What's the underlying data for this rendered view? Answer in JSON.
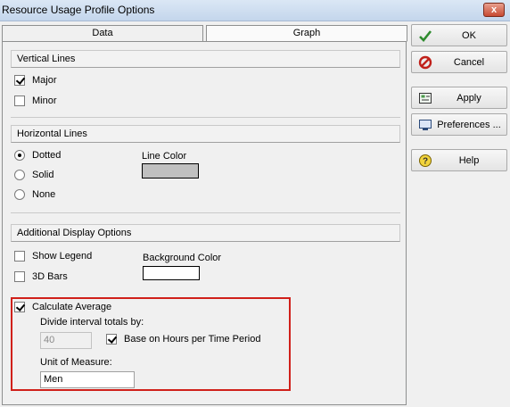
{
  "window": {
    "title": "Resource Usage Profile Options",
    "close_label": "x"
  },
  "tabs": [
    {
      "label": "Data"
    },
    {
      "label": "Graph"
    }
  ],
  "vertical_lines": {
    "header": "Vertical Lines",
    "major": {
      "label": "Major",
      "checked": true
    },
    "minor": {
      "label": "Minor",
      "checked": false
    }
  },
  "horizontal_lines": {
    "header": "Horizontal Lines",
    "options": [
      {
        "label": "Dotted",
        "selected": true
      },
      {
        "label": "Solid",
        "selected": false
      },
      {
        "label": "None",
        "selected": false
      }
    ],
    "line_color_label": "Line Color",
    "line_color": "#c0c0c0"
  },
  "additional": {
    "header": "Additional Display Options",
    "show_legend": {
      "label": "Show Legend",
      "checked": false
    },
    "bars_3d": {
      "label": "3D Bars",
      "checked": false
    },
    "background_color_label": "Background Color",
    "background_color": "#ffffff",
    "calculate_average": {
      "label": "Calculate Average",
      "checked": true
    },
    "divide_label": "Divide interval totals by:",
    "divide_value": "40",
    "base_on_hours": {
      "label": "Base on Hours per Time Period",
      "checked": true
    },
    "unit_label": "Unit of Measure:",
    "unit_value": "Men"
  },
  "buttons": {
    "ok": "OK",
    "cancel": "Cancel",
    "apply": "Apply",
    "preferences": "Preferences ...",
    "help": "Help"
  },
  "colors": {
    "highlight": "#d0201a",
    "ok_check": "#2e8b2e",
    "cancel_red": "#c0201a",
    "help_yellow": "#f2d43c"
  }
}
